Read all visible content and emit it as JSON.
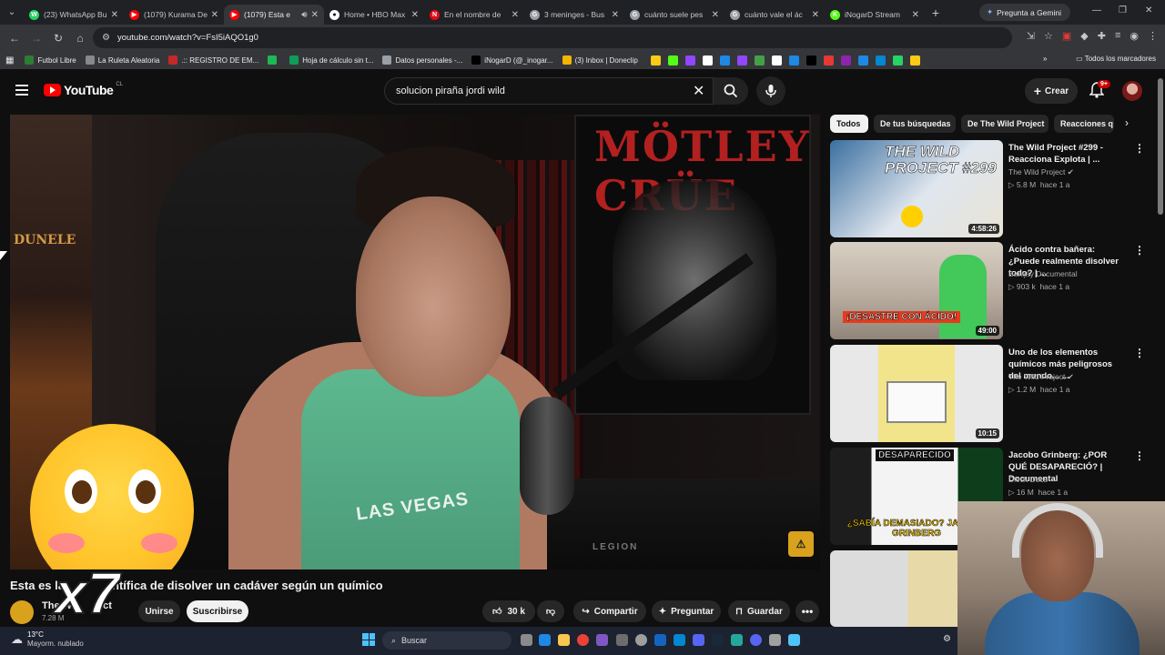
{
  "browser": {
    "tabs": [
      {
        "title": "(23) WhatsApp Bu",
        "color": "#25d366",
        "glyph": "W",
        "active": false
      },
      {
        "title": "(1079) Kurama De",
        "color": "#ff0000",
        "glyph": "▶",
        "active": false
      },
      {
        "title": "(1079) Esta e",
        "color": "#ff0000",
        "glyph": "▶",
        "active": true
      },
      {
        "title": "Home • HBO Max",
        "color": "#ffffff",
        "glyph": "●",
        "active": false
      },
      {
        "title": "En el nombre de",
        "color": "#e50914",
        "glyph": "N",
        "active": false
      },
      {
        "title": "3 meninges - Bus",
        "color": "#9aa0a6",
        "glyph": "G",
        "active": false
      },
      {
        "title": "cuánto suele pes",
        "color": "#9aa0a6",
        "glyph": "G",
        "active": false
      },
      {
        "title": "cuánto vale el ác",
        "color": "#9aa0a6",
        "glyph": "G",
        "active": false
      },
      {
        "title": "iNogarD Stream",
        "color": "#53fc18",
        "glyph": "K",
        "active": false
      }
    ],
    "new_tab": "+",
    "gemini_label": "Pregunta a Gemini",
    "url": "youtube.com/watch?v=FsI5iAQO1g0",
    "bookmarks": [
      {
        "label": "Futbol Libre",
        "color": "#2e7d32"
      },
      {
        "label": "La Ruleta Aleatoria",
        "color": "#888888"
      },
      {
        "label": ".:: REGISTRO DE EM...",
        "color": "#c62828"
      },
      {
        "label": "",
        "color": "#1db954"
      },
      {
        "label": "Hoja de cálculo sin t...",
        "color": "#0f9d58"
      },
      {
        "label": "Datos personales -...",
        "color": "#9aa0a6"
      },
      {
        "label": "iNogarD (@_inogar...",
        "color": "#000000"
      },
      {
        "label": "(3) Inbox | Doneclip",
        "color": "#f4b400"
      }
    ],
    "bookmarks_all": "Todos los marcadores"
  },
  "youtube": {
    "logo_text": "YouTube",
    "logo_country": "CL",
    "search_query": "solucion piraña jordi wild",
    "create_label": "Crear",
    "notif_count": "9+"
  },
  "video": {
    "title": "Esta es la forma más científica de disolver un cadáver según un químico",
    "title_visible_start": "Esta es la",
    "title_visible_end": "ntífica de disolver un cadáver según un químico",
    "channel": "The Wild Project",
    "channel_visible": "The W",
    "channel_visible_end": "ect",
    "subs": "7.28 M",
    "join_label": "Unirse",
    "subscribe_label": "Suscribirse",
    "likes": "30 k",
    "share_label": "Compartir",
    "ask_label": "Preguntar",
    "save_label": "Guardar",
    "poster_text": "MÖTLEY CRÜE",
    "left_poster_text": "DUNELE",
    "shirt_text": "LAS VEGAS",
    "desk_text": "LEGION",
    "overlay_multiplier": "x7"
  },
  "chips": [
    {
      "label": "Todos",
      "active": true
    },
    {
      "label": "De tus búsquedas",
      "active": false
    },
    {
      "label": "De The Wild Project",
      "active": false
    },
    {
      "label": "Reacciones q",
      "active": false
    }
  ],
  "recommendations": [
    {
      "title": "The Wild Project #299 - Reacciona Explota | ...",
      "channel": "The Wild Project",
      "verified": true,
      "views": "5.8 M",
      "age": "hace 1 a",
      "duration": "4:58:26",
      "thumb_text": "THE WILD PROJECT #299"
    },
    {
      "title": "Ácido contra bañera: ¿Puede realmente disolver todo? | ...",
      "channel": "Banijay Documental",
      "verified": false,
      "views": "903 k",
      "age": "hace 1 a",
      "duration": "49:00",
      "thumb_text": "¡DESASTRE CON ÁCIDO!"
    },
    {
      "title": "Uno de los elementos químicos más peligrosos del mundo... ...",
      "channel": "The Wild Project",
      "verified": true,
      "views": "1.2 M",
      "age": "hace 1 a",
      "duration": "10:15",
      "thumb_text": ""
    },
    {
      "title": "Jacobo Grinberg: ¿POR QUÉ DESAPARECIÓ? | Documental",
      "channel": "Dieck Docs",
      "verified": false,
      "views": "16 M",
      "age": "hace 1 a",
      "duration": "",
      "thumb_text": "¿SABÍA DEMASIADO? JACOBO GRINBERG",
      "thumb_top": "DESAPARECIDO"
    }
  ],
  "taskbar": {
    "temp": "13°C",
    "weather": "Mayorm. nublado",
    "search_placeholder": "Buscar"
  }
}
